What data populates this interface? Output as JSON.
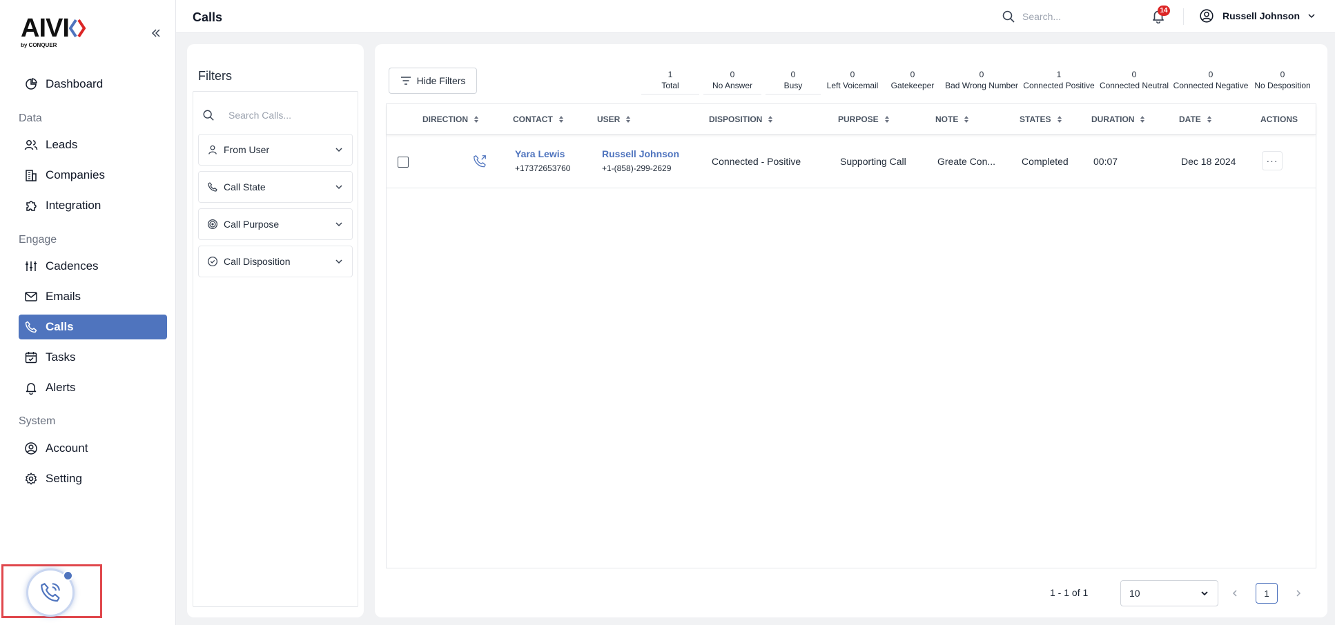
{
  "brand": {
    "logo_text": "AIVI",
    "logo_sub": "by CONQUER"
  },
  "sidebar": {
    "sections": [
      "Data",
      "Engage",
      "System"
    ],
    "items": [
      {
        "label": "Dashboard",
        "icon": "dashboard-icon"
      },
      {
        "label": "Leads",
        "icon": "users-icon"
      },
      {
        "label": "Companies",
        "icon": "building-icon"
      },
      {
        "label": "Integration",
        "icon": "puzzle-icon"
      },
      {
        "label": "Cadences",
        "icon": "sliders-icon"
      },
      {
        "label": "Emails",
        "icon": "mail-icon"
      },
      {
        "label": "Calls",
        "icon": "phone-icon",
        "active": true
      },
      {
        "label": "Tasks",
        "icon": "calendar-check-icon"
      },
      {
        "label": "Alerts",
        "icon": "bell-icon"
      },
      {
        "label": "Account",
        "icon": "user-circle-icon"
      },
      {
        "label": "Setting",
        "icon": "gear-icon"
      }
    ]
  },
  "topbar": {
    "title": "Calls",
    "search_placeholder": "Search...",
    "notification_count": "14",
    "user_name": "Russell Johnson"
  },
  "filters": {
    "title": "Filters",
    "search_placeholder": "Search Calls...",
    "dropdowns": [
      "From User",
      "Call State",
      "Call Purpose",
      "Call Disposition"
    ]
  },
  "toolbar": {
    "hide_filters_label": "Hide Filters"
  },
  "stats": [
    {
      "count": "1",
      "label": "Total"
    },
    {
      "count": "0",
      "label": "No Answer"
    },
    {
      "count": "0",
      "label": "Busy"
    },
    {
      "count": "0",
      "label": "Left Voicemail"
    },
    {
      "count": "0",
      "label": "Gatekeeper"
    },
    {
      "count": "0",
      "label": "Bad Wrong Number"
    },
    {
      "count": "1",
      "label": "Connected Positive"
    },
    {
      "count": "0",
      "label": "Connected Neutral"
    },
    {
      "count": "0",
      "label": "Connected Negative"
    },
    {
      "count": "0",
      "label": "No Desposition"
    }
  ],
  "table": {
    "columns": [
      "DIRECTION",
      "CONTACT",
      "USER",
      "DISPOSITION",
      "PURPOSE",
      "NOTE",
      "STATES",
      "DURATION",
      "DATE",
      "ACTIONS"
    ],
    "rows": [
      {
        "contact_name": "Yara Lewis",
        "contact_phone": "+17372653760",
        "user_name": "Russell Johnson",
        "user_phone": "+1-(858)-299-2629",
        "disposition": "Connected - Positive",
        "purpose": "Supporting Call",
        "note": "Greate Con...",
        "state": "Completed",
        "duration": "00:07",
        "date": "Dec 18 2024",
        "actions": "···"
      }
    ]
  },
  "pagination": {
    "range_text": "1 - 1 of 1",
    "per_page": "10",
    "current_page": "1"
  },
  "colors": {
    "accent": "#4f74be",
    "badge": "#dc2626",
    "highlight_border": "#e0474c"
  }
}
